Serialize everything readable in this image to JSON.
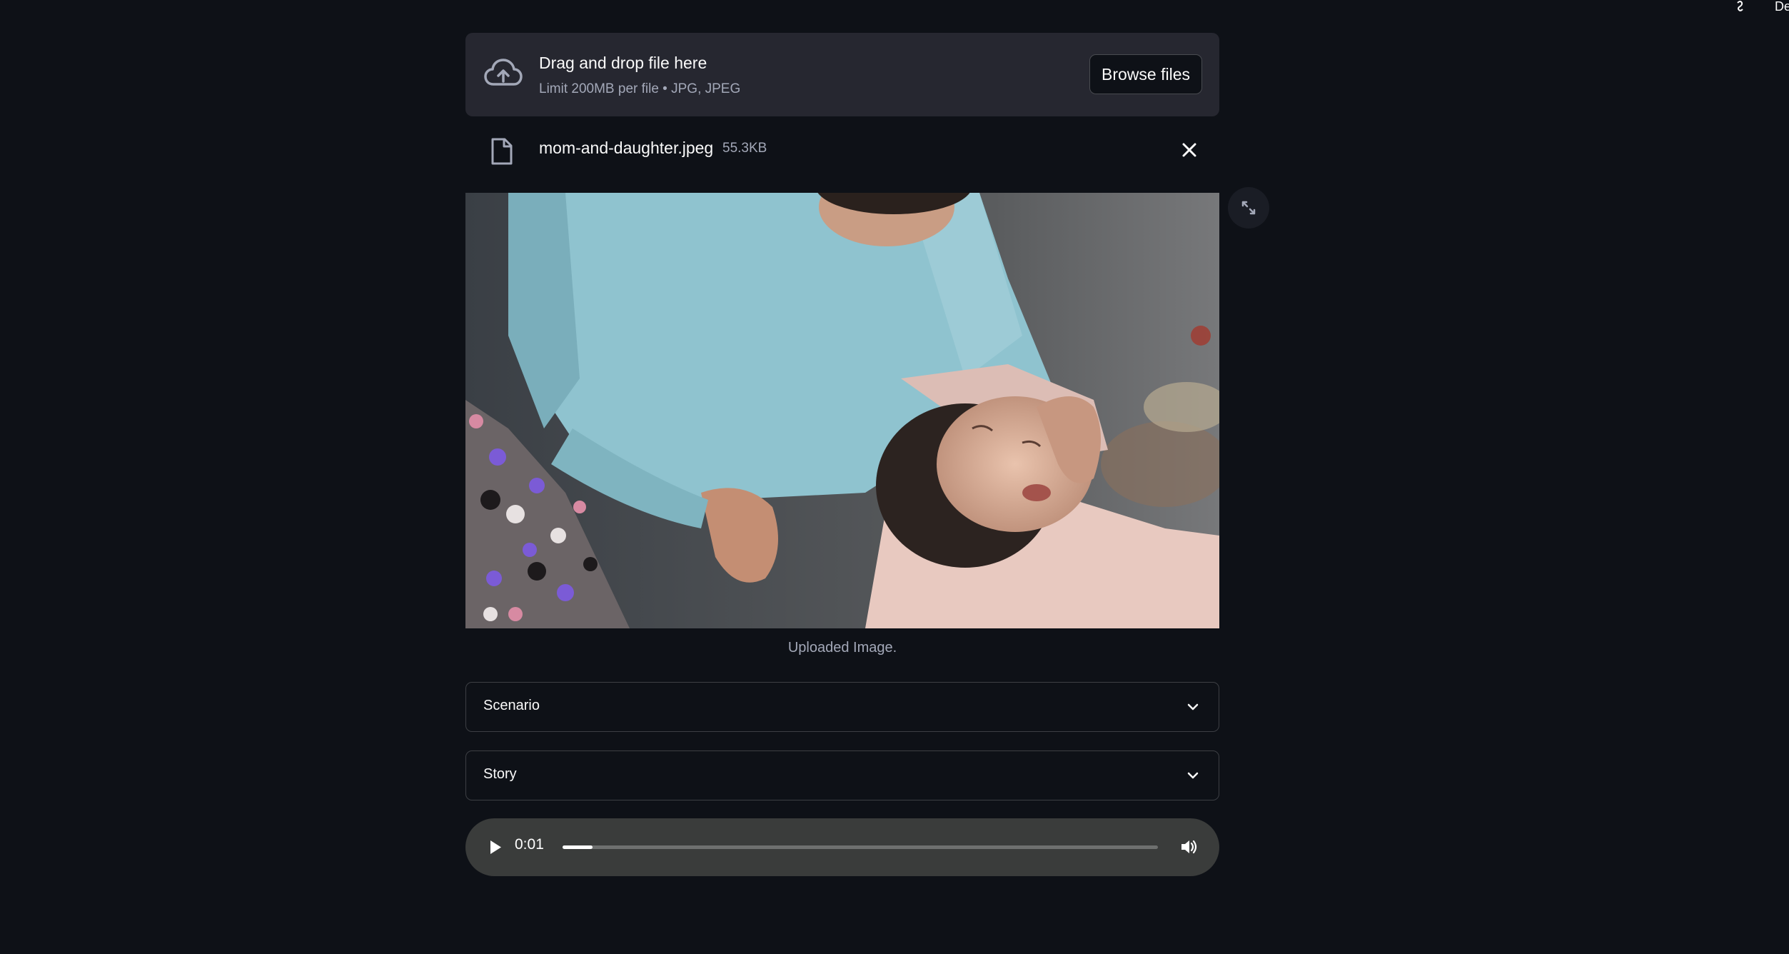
{
  "header": {
    "icon": "loading-squiggle-icon",
    "text": "De"
  },
  "uploader": {
    "title": "Drag and drop file here",
    "subtitle": "Limit 200MB per file • JPG, JPEG",
    "browse_label": "Browse files",
    "icon": "cloud-upload-icon"
  },
  "file": {
    "name": "mom-and-daughter.jpeg",
    "size": "55.3KB",
    "icon": "file-icon",
    "remove_icon": "close-icon"
  },
  "image": {
    "caption": "Uploaded Image.",
    "fullscreen_icon": "expand-icon"
  },
  "expanders": [
    {
      "label": "Scenario",
      "icon": "chevron-down-icon"
    },
    {
      "label": "Story",
      "icon": "chevron-down-icon"
    }
  ],
  "audio": {
    "time": "0:01",
    "progress": 0.05,
    "play_icon": "play-icon",
    "volume_icon": "volume-icon"
  },
  "colors": {
    "background": "#0e1117",
    "dropzone": "#262730",
    "audio_bar": "#3a3c3b",
    "muted_text": "#a3a8b8"
  }
}
